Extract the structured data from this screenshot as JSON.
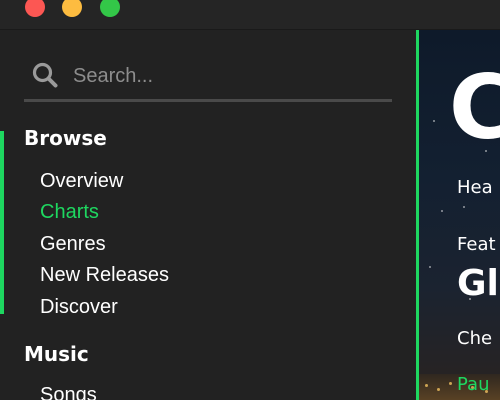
{
  "window": {
    "traffic_lights": {
      "close": "#fc5753",
      "minimize": "#fdbc40",
      "zoom": "#33c748"
    }
  },
  "sidebar": {
    "search": {
      "placeholder": "Search..."
    },
    "sections": [
      {
        "title": "Browse",
        "items": [
          {
            "label": "Overview",
            "selected": false
          },
          {
            "label": "Charts",
            "selected": true
          },
          {
            "label": "Genres",
            "selected": false
          },
          {
            "label": "New Releases",
            "selected": false
          },
          {
            "label": "Discover",
            "selected": false
          }
        ]
      },
      {
        "title": "Music",
        "items": [
          {
            "label": "Songs",
            "selected": false
          }
        ]
      }
    ]
  },
  "main": {
    "big_letter": "C",
    "line1": "Hea",
    "line2": "Feat",
    "line3": "Gl",
    "line4": "Che",
    "line5": "Pau"
  },
  "colors": {
    "accent": "#1ed760",
    "sidebar_bg": "#222222",
    "text": "#ffffff"
  }
}
